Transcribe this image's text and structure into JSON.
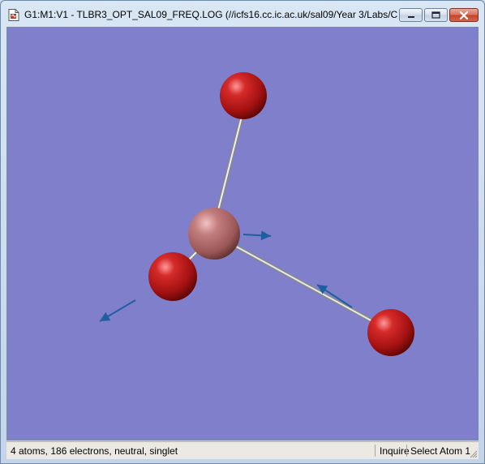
{
  "window": {
    "title": "G1:M1:V1 - TLBR3_OPT_SAL09_FREQ.LOG (//icfs16.cc.ic.ac.uk/sal09/Year 3/Labs/Co..."
  },
  "icons": {
    "app": "document-icon",
    "minimize": "minimize-icon",
    "maximize": "maximize-icon",
    "close": "close-icon"
  },
  "colors": {
    "viewport_background": "#7f7fcb",
    "bromine_atom": "#b01818",
    "thallium_atom": "#b56a6a",
    "bond": "#e6e6e6",
    "displacement_vector": "#1f5f9f"
  },
  "molecule": {
    "atom_count": 4,
    "atoms": [
      {
        "element": "Tl",
        "role": "central"
      },
      {
        "element": "Br",
        "role": "terminal-top"
      },
      {
        "element": "Br",
        "role": "terminal-front"
      },
      {
        "element": "Br",
        "role": "terminal-right"
      }
    ],
    "bonds": 3,
    "displacement_vectors": 3
  },
  "status": {
    "info": "4 atoms, 186 electrons, neutral, singlet",
    "mode": "Inquire",
    "selection": "Select Atom 1"
  }
}
